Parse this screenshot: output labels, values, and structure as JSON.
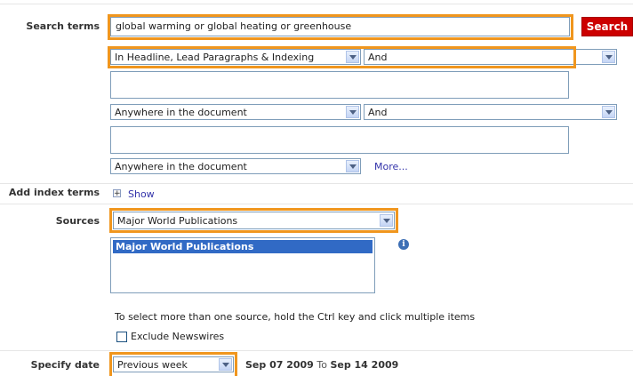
{
  "search": {
    "label": "Search terms",
    "query": "global warming or global heating or greenhouse",
    "button": "Search",
    "row1": {
      "field": "In Headline, Lead Paragraphs & Indexing",
      "operator": "And"
    },
    "row2": {
      "text": "",
      "field": "Anywhere in the document",
      "operator": "And"
    },
    "row3": {
      "text": "",
      "field": "Anywhere in the document"
    },
    "more": "More..."
  },
  "index": {
    "label": "Add index terms",
    "toggle": "+",
    "show": "Show"
  },
  "sources": {
    "label": "Sources",
    "selected": "Major World Publications",
    "list": [
      "Major World Publications"
    ],
    "info_icon": "info-icon",
    "hint": "To select more than one source, hold the Ctrl key and click multiple items",
    "exclude_label": "Exclude Newswires",
    "exclude_checked": false
  },
  "date": {
    "label": "Specify date",
    "selected": "Previous week",
    "from": "Sep 07 2009",
    "to_word": "To",
    "to": "Sep 14 2009"
  },
  "colors": {
    "highlight": "#f0961e",
    "search_button": "#cc0000",
    "link": "#3333aa",
    "selection": "#316ac5"
  }
}
